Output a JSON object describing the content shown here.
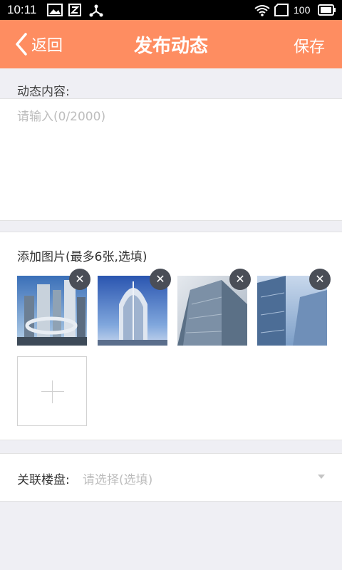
{
  "status_bar": {
    "time": "10:11",
    "battery_percent": "100"
  },
  "header": {
    "back_label": "返回",
    "title": "发布动态",
    "save_label": "保存",
    "background_color": "#fe8d61"
  },
  "content": {
    "label": "动态内容:",
    "value": "",
    "placeholder": "请输入(0/2000)"
  },
  "images": {
    "title": "添加图片(最多6张,选填)",
    "remove_glyph": "✕",
    "items": [
      {
        "icon": "building-photo-1"
      },
      {
        "icon": "building-photo-2"
      },
      {
        "icon": "building-photo-3"
      },
      {
        "icon": "building-photo-4"
      }
    ]
  },
  "related": {
    "label": "关联楼盘:",
    "value": "请选择(选填)"
  }
}
